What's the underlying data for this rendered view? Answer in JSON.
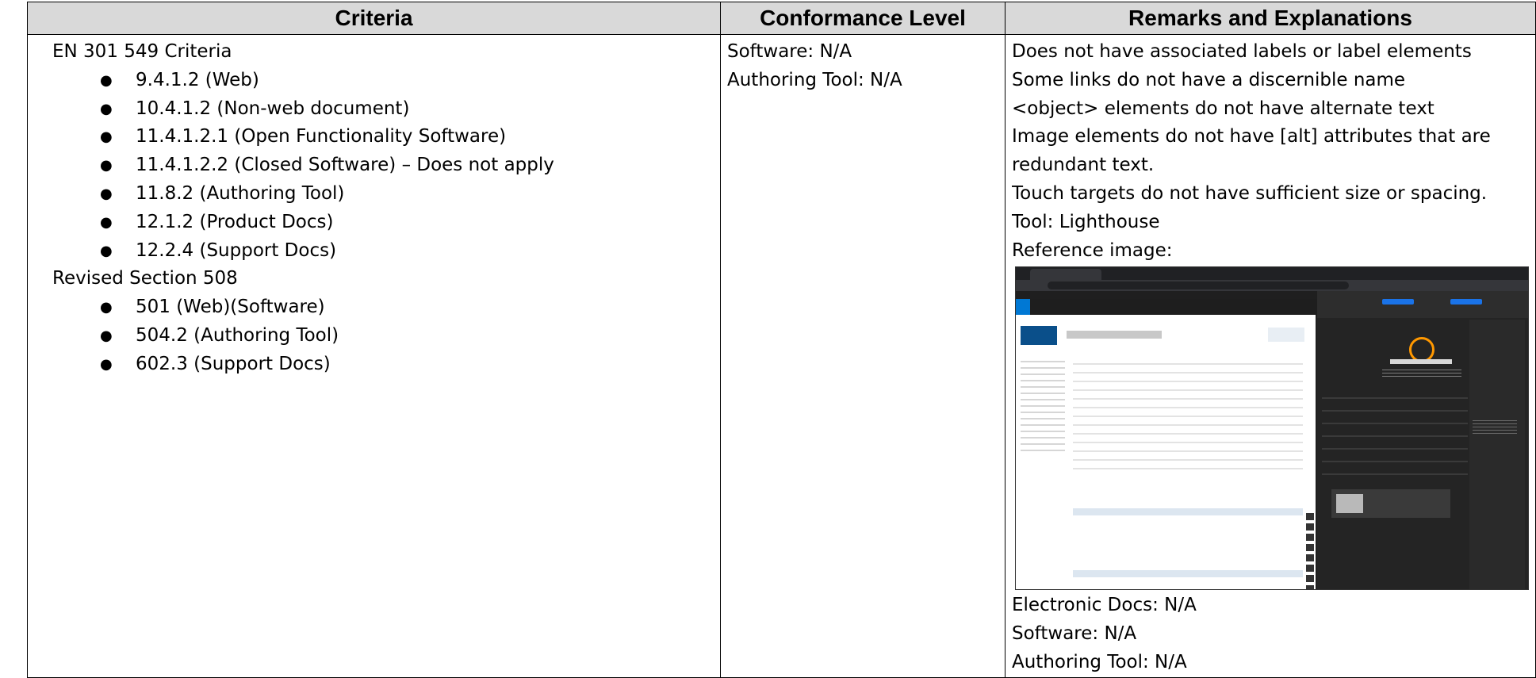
{
  "headers": {
    "criteria": "Criteria",
    "conformance": "Conformance Level",
    "remarks": "Remarks and Explanations"
  },
  "criteria": {
    "en_heading": "EN 301 549 Criteria",
    "en_items": [
      "9.4.1.2 (Web)",
      "10.4.1.2 (Non-web document)",
      "11.4.1.2.1 (Open Functionality Software)",
      "11.4.1.2.2 (Closed Software) – Does not apply",
      "11.8.2 (Authoring Tool)",
      "12.1.2 (Product Docs)",
      "12.2.4 (Support Docs)"
    ],
    "s508_heading": "Revised Section 508",
    "s508_items": [
      "501 (Web)(Software)",
      "504.2 (Authoring Tool)",
      "602.3 (Support Docs)"
    ]
  },
  "conformance": {
    "software": "Software: N/A",
    "authoring_tool": "Authoring Tool: N/A"
  },
  "remarks": {
    "lines": [
      "Does not have associated labels or label elements",
      "Some links do not have a discernible name",
      "<object> elements do not have alternate text",
      "Image elements do not have [alt] attributes that are",
      "redundant text.",
      "Touch targets do not have sufficient size or spacing.",
      "Tool: Lighthouse",
      "Reference image:"
    ],
    "after_lines": [
      "Electronic Docs: N/A",
      "Software: N/A",
      "Authoring Tool: N/A"
    ]
  }
}
